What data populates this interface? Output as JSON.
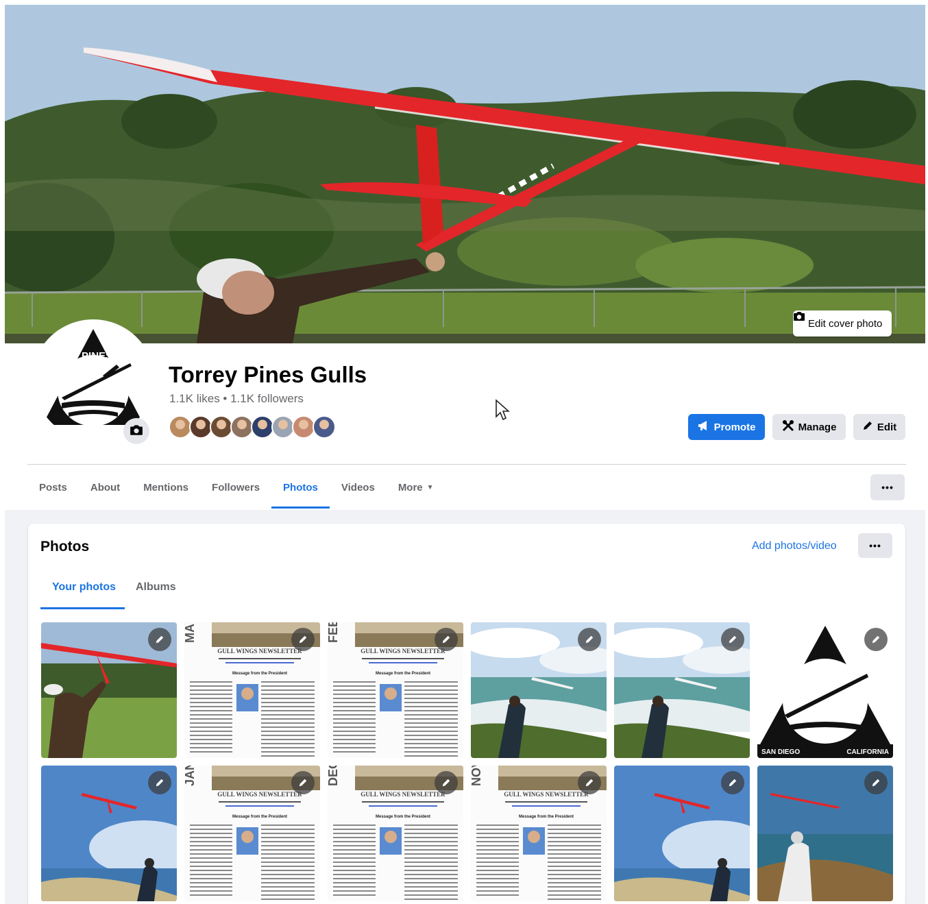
{
  "cover": {
    "edit_cover_label": "Edit cover photo"
  },
  "page": {
    "title": "Torrey Pines Gulls",
    "stats": "1.1K likes • 1.1K followers",
    "follower_colors": [
      "#b98a5e",
      "#5a3a2a",
      "#6b4b32",
      "#8d7260",
      "#2d3f6b",
      "#9aa4b2",
      "#c78a70",
      "#4a5a8a"
    ]
  },
  "actions": {
    "promote": "Promote",
    "manage": "Manage",
    "edit": "Edit"
  },
  "tabs": [
    {
      "label": "Posts"
    },
    {
      "label": "About"
    },
    {
      "label": "Mentions"
    },
    {
      "label": "Followers"
    },
    {
      "label": "Photos",
      "active": true
    },
    {
      "label": "Videos"
    },
    {
      "label": "More"
    }
  ],
  "photos": {
    "title": "Photos",
    "add_label": "Add photos/video",
    "subtabs": [
      "Your photos",
      "Albums"
    ],
    "grid": [
      {
        "kind": "glider-launch"
      },
      {
        "kind": "newsletter",
        "month": "MA"
      },
      {
        "kind": "newsletter",
        "month": "FEB"
      },
      {
        "kind": "cliff-launch"
      },
      {
        "kind": "cliff-launch"
      },
      {
        "kind": "logo"
      },
      {
        "kind": "sky-launch"
      },
      {
        "kind": "newsletter",
        "month": "JAN"
      },
      {
        "kind": "newsletter",
        "month": "DEC"
      },
      {
        "kind": "newsletter",
        "month": "NOV"
      },
      {
        "kind": "sky-launch"
      },
      {
        "kind": "sea-launch"
      }
    ]
  },
  "logo": {
    "top_text": "TORREY PINES GULLS",
    "left_caption": "SAN DIEGO",
    "right_caption": "CALIFORNIA"
  },
  "newsletter": {
    "masthead": "GULL WINGS NEWSLETTER",
    "message_heading": "Message from the President"
  },
  "colors": {
    "accent": "#1b74e4",
    "glider_red": "#e3262a"
  }
}
